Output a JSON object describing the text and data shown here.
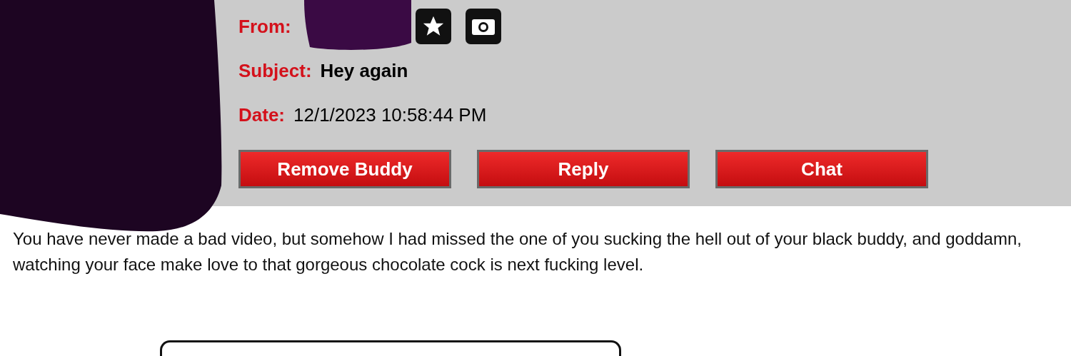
{
  "header": {
    "from_label": "From:",
    "subject_label": "Subject:",
    "subject": "Hey again",
    "date_label": "Date:",
    "date": "12/1/2023 10:58:44 PM"
  },
  "buttons": [
    {
      "label": "Remove Buddy"
    },
    {
      "label": "Reply"
    },
    {
      "label": "Chat"
    }
  ],
  "body": "You have never made a bad video, but somehow I had missed the one of you sucking the hell out of your black buddy, and goddamn, watching your face make love to that gorgeous chocolate cock is next fucking level."
}
